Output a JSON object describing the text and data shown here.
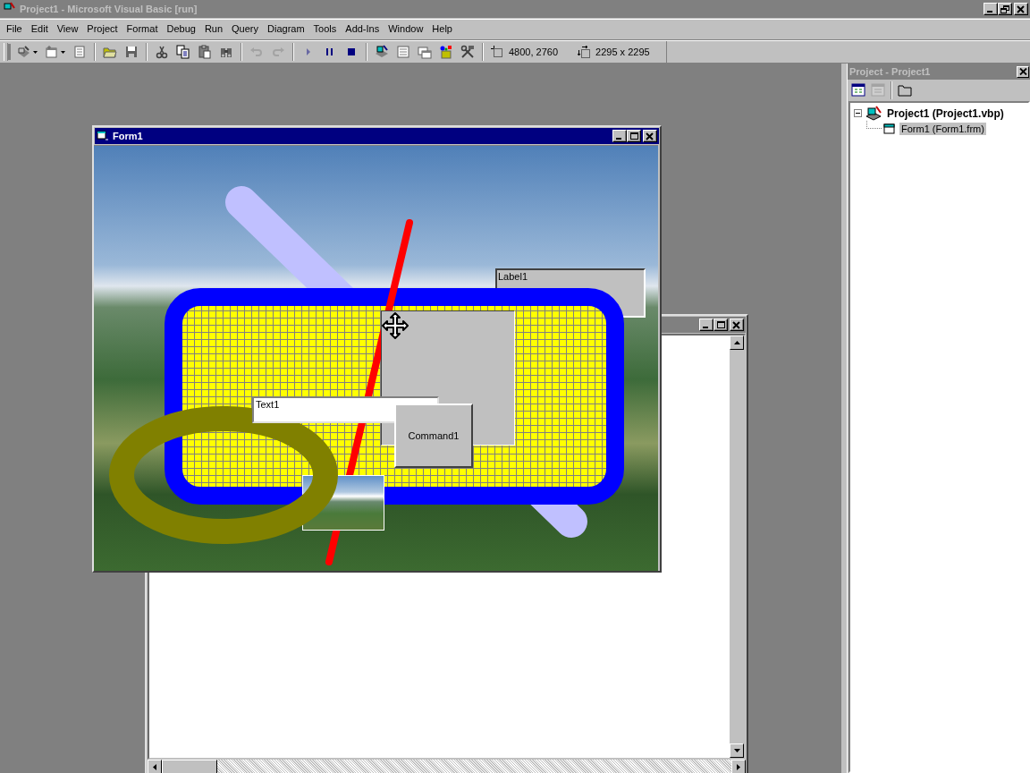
{
  "main_window": {
    "title": "Project1 - Microsoft Visual Basic [run]",
    "active": false
  },
  "menu": [
    "File",
    "Edit",
    "View",
    "Project",
    "Format",
    "Debug",
    "Run",
    "Query",
    "Diagram",
    "Tools",
    "Add-Ins",
    "Window",
    "Help"
  ],
  "toolbar": {
    "buttons": [
      {
        "kind": "add-project",
        "disabled": false
      },
      {
        "kind": "dropdown-caret",
        "disabled": false
      },
      {
        "kind": "add-form",
        "disabled": false
      },
      {
        "kind": "dropdown-caret",
        "disabled": false
      },
      {
        "kind": "menu-editor",
        "disabled": false
      },
      {
        "kind": "separator"
      },
      {
        "kind": "open",
        "disabled": false
      },
      {
        "kind": "save",
        "disabled": false
      },
      {
        "kind": "separator"
      },
      {
        "kind": "cut",
        "disabled": false
      },
      {
        "kind": "copy",
        "disabled": false
      },
      {
        "kind": "paste",
        "disabled": false
      },
      {
        "kind": "find",
        "disabled": false
      },
      {
        "kind": "separator"
      },
      {
        "kind": "undo",
        "disabled": true
      },
      {
        "kind": "redo",
        "disabled": true
      },
      {
        "kind": "separator"
      },
      {
        "kind": "start",
        "disabled": true
      },
      {
        "kind": "break",
        "disabled": false
      },
      {
        "kind": "end",
        "disabled": false
      },
      {
        "kind": "separator"
      },
      {
        "kind": "project-explorer",
        "disabled": false
      },
      {
        "kind": "properties",
        "disabled": false
      },
      {
        "kind": "form-layout",
        "disabled": false
      },
      {
        "kind": "object-browser",
        "disabled": false
      },
      {
        "kind": "toolbox",
        "disabled": false
      }
    ],
    "position": "4800, 2760",
    "size": "2295 x 2295"
  },
  "code_window": {
    "active": false
  },
  "form_window": {
    "title": "Form1",
    "active": true,
    "label": "Label1",
    "textbox": "Text1",
    "command_button": "Command1"
  },
  "project_panel": {
    "title": "Project - Project1",
    "buttons": [
      {
        "kind": "view-code",
        "disabled": false
      },
      {
        "kind": "view-object",
        "disabled": true
      },
      {
        "kind": "toggle-folders",
        "disabled": false
      }
    ],
    "tree": [
      {
        "label": "Project1 (Project1.vbp)",
        "expanded": true,
        "selected": false,
        "children": [
          {
            "label": "Form1 (Form1.frm)",
            "selected": true
          }
        ]
      }
    ]
  }
}
